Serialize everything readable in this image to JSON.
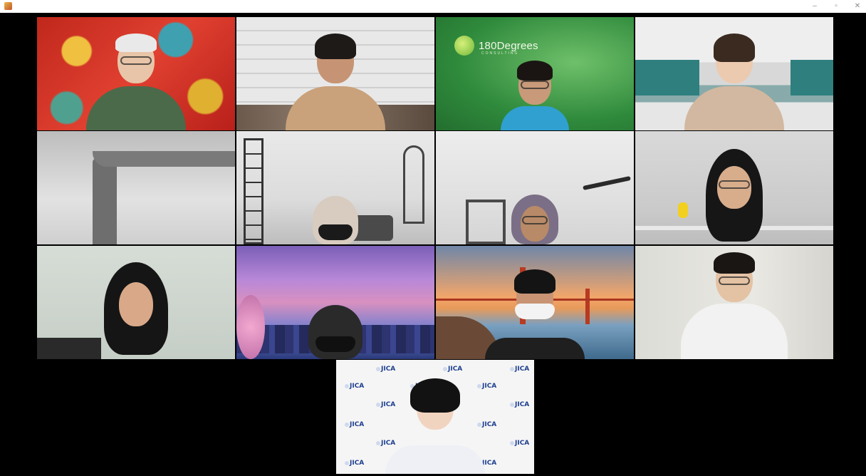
{
  "window": {
    "minimize_glyph": "–",
    "maximize_glyph": "▫",
    "close_glyph": "✕"
  },
  "participants": [
    {
      "id": "p1",
      "background": "red-mosaic-art"
    },
    {
      "id": "p2",
      "background": "office-ceiling"
    },
    {
      "id": "p3",
      "background": "green-branded"
    },
    {
      "id": "p4",
      "background": "office-cubicles"
    },
    {
      "id": "p5",
      "background": "room-ceiling-pillar"
    },
    {
      "id": "p6",
      "background": "loft-interior"
    },
    {
      "id": "p7",
      "background": "room-ceiling-fan"
    },
    {
      "id": "p8",
      "background": "plain-wall"
    },
    {
      "id": "p9",
      "background": "plain-wall"
    },
    {
      "id": "p10",
      "background": "anime-city-sky"
    },
    {
      "id": "p11",
      "background": "golden-gate-bridge"
    },
    {
      "id": "p12",
      "background": "plain-wall"
    },
    {
      "id": "p13",
      "background": "jica-logo-wall"
    }
  ],
  "branding": {
    "tile3_logo": "180Degrees",
    "tile3_sublogo": "CONSULTING",
    "jica_logo_text": "JICA"
  },
  "colors": {
    "stage_bg": "#000000",
    "titlebar_bg": "#ffffff"
  }
}
